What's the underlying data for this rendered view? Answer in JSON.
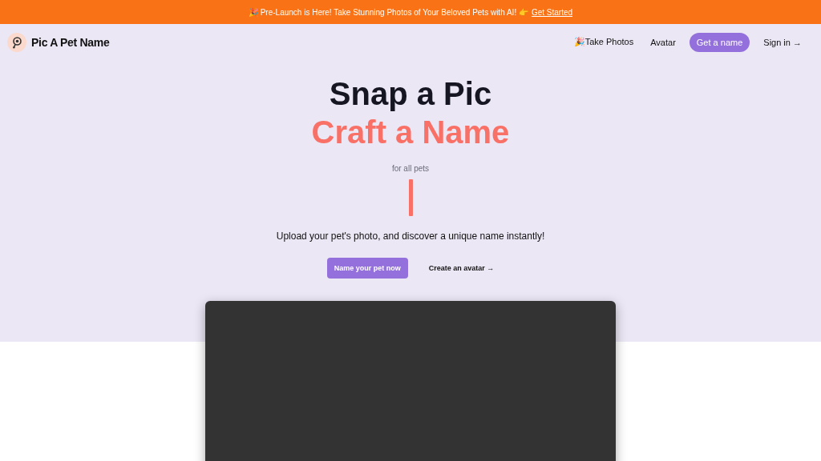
{
  "banner": {
    "text": "🎉 Pre-Launch is Here! Take Stunning Photos of Your Beloved Pets with AI! 👉",
    "link": "Get Started"
  },
  "nav": {
    "brand": "Pic A Pet Name",
    "links": [
      {
        "label": "🎉Take Photos",
        "kind": "link"
      },
      {
        "label": "Avatar",
        "kind": "link"
      },
      {
        "label": "Get a name",
        "kind": "pill"
      },
      {
        "label": "Sign in →",
        "kind": "link"
      }
    ]
  },
  "hero": {
    "title": "Snap a Pic",
    "subtitle": "Craft a Name",
    "tagline": "for all pets",
    "description": "Upload your pet's photo, and discover a unique name instantly!",
    "buttons": [
      {
        "label": "Name your pet now",
        "kind": "primary"
      },
      {
        "label": "Create an avatar →",
        "kind": "link"
      }
    ]
  }
}
